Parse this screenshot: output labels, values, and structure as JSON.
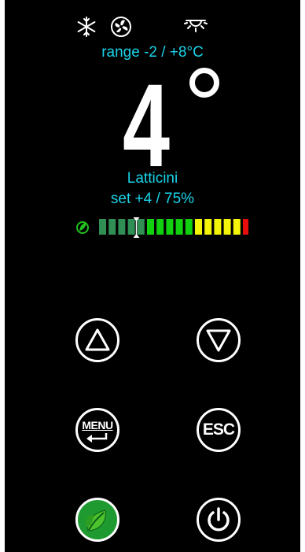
{
  "status_icons": [
    "snowflake-icon",
    "fan-icon",
    "light-icon"
  ],
  "range": {
    "text": "range -2 / +8°C"
  },
  "temperature": {
    "value": "4",
    "unit_symbol": "°"
  },
  "product": {
    "name": "Latticini"
  },
  "setpoint": {
    "text": "set +4 / 75%"
  },
  "level_bar": {
    "leaf_color": "#22c21e",
    "segments": [
      "#2f8f55",
      "#2f8f55",
      "#2f8f55",
      "#2f8f55",
      "#2f8f55",
      "#10d010",
      "#10d010",
      "#10d010",
      "#10d010",
      "#10d010",
      "#f4f40a",
      "#f4f40a",
      "#f4f40a",
      "#f4f40a",
      "#f4f40a",
      "#e80d0d"
    ],
    "marker_index": 4
  },
  "buttons": {
    "up": "up-arrow-icon",
    "down": "down-arrow-icon",
    "menu": {
      "label": "MENU"
    },
    "esc": {
      "label": "ESC"
    },
    "eco": "leaf-icon",
    "power": "power-icon"
  },
  "colors": {
    "text_accent": "#19d3e8",
    "background": "#000000",
    "eco_button": "#1e9a31"
  }
}
